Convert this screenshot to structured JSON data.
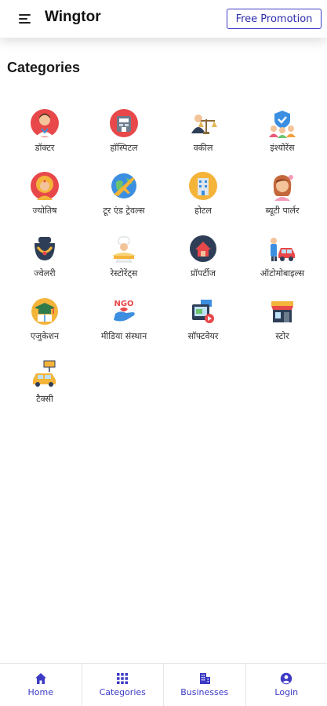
{
  "app": {
    "title": "Wingtor",
    "promo_label": "Free Promotion"
  },
  "section": {
    "title": "Categories"
  },
  "colors": {
    "accent": "#3d3bc4",
    "text": "#1a1a1a"
  },
  "categories": [
    {
      "label": "डॉक्टर",
      "icon": "doctor-icon"
    },
    {
      "label": "हॉस्पिटल",
      "icon": "hospital-icon"
    },
    {
      "label": "वकील",
      "icon": "lawyer-icon"
    },
    {
      "label": "इंश्योरेंस",
      "icon": "insurance-icon"
    },
    {
      "label": "ज्योतिष",
      "icon": "astrologer-icon"
    },
    {
      "label": "टूर एंड ट्रेवल्स",
      "icon": "travel-icon"
    },
    {
      "label": "होटल",
      "icon": "hotel-icon"
    },
    {
      "label": "ब्यूटी पार्लर",
      "icon": "beauty-parlour-icon"
    },
    {
      "label": "ज्वेलरी",
      "icon": "jewellery-icon"
    },
    {
      "label": "रेस्टोरेंट्स",
      "icon": "restaurant-chef-icon"
    },
    {
      "label": "प्रॉपर्टीज",
      "icon": "property-icon"
    },
    {
      "label": "ऑटोमोबाइल्स",
      "icon": "automobile-icon"
    },
    {
      "label": "एजुकेशन",
      "icon": "education-icon"
    },
    {
      "label": "मीडिया संस्थान",
      "icon": "ngo-media-icon"
    },
    {
      "label": "सॉफ्टवेयर",
      "icon": "software-icon"
    },
    {
      "label": "स्टोर",
      "icon": "store-icon"
    },
    {
      "label": "टैक्सी",
      "icon": "taxi-icon"
    }
  ],
  "bottom_nav": [
    {
      "label": "Home",
      "icon": "home-icon"
    },
    {
      "label": "Categories",
      "icon": "grid-icon"
    },
    {
      "label": "Businesses",
      "icon": "building-icon"
    },
    {
      "label": "Login",
      "icon": "user-icon"
    }
  ]
}
